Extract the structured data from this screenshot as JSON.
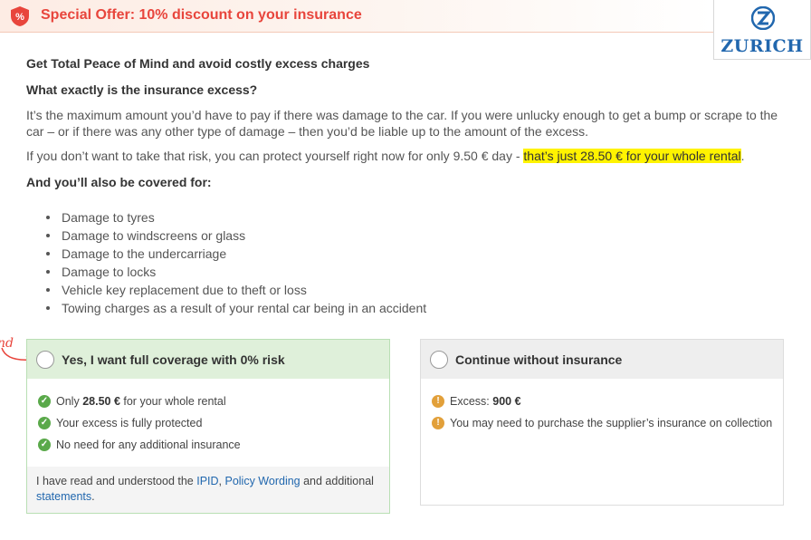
{
  "banner": {
    "title": "Special Offer: 10% discount on your insurance",
    "badge": "%"
  },
  "logo": {
    "text": "ZURICH"
  },
  "intro": {
    "heading": "Get Total Peace of Mind and avoid costly excess charges",
    "question": "What exactly is the insurance excess?",
    "answer": "It’s the maximum amount you’d have to pay if there was damage to the car. If you were unlucky enough to get a bump or scrape to the car – or if there was any other type of damage – then you’d be liable up to the amount of the excess.",
    "offer_text": "If you don’t want to take that risk, you can protect yourself right now for only 9.50 € day - ",
    "offer_highlight": "that’s just 28.50 € for your whole rental",
    "offer_end": ".",
    "covered_heading": "And you’ll also be covered for:"
  },
  "coverage_items": [
    "Damage to tyres",
    "Damage to windscreens or glass",
    "Damage to the undercarriage",
    "Damage to locks",
    "Vehicle key replacement due to theft or loss",
    "Towing charges as a result of your rental car being in an accident"
  ],
  "side_note": "nd",
  "option_yes": {
    "title": "Yes, I want full coverage with 0% risk",
    "f1_pre": "Only ",
    "f1_bold": "28.50 €",
    "f1_post": " for your whole rental",
    "f2": "Your excess is fully protected",
    "f3": "No need for any additional insurance",
    "legal_pre": "I have read and understood the ",
    "link_ipid": "IPID",
    "sep": ", ",
    "link_policy": "Policy Wording",
    "legal_mid": " and additional ",
    "link_statements": "statements",
    "legal_end": "."
  },
  "option_no": {
    "title": "Continue without insurance",
    "w1_pre": "Excess: ",
    "w1_bold": "900 €",
    "w2": "You may need to purchase the supplier’s insurance on collection"
  },
  "colors": {
    "accent_red": "#e8453c",
    "zurich_blue": "#2167ae",
    "highlight": "#fff300",
    "ok_green": "#5aa94a",
    "warn_orange": "#e2a03a"
  }
}
